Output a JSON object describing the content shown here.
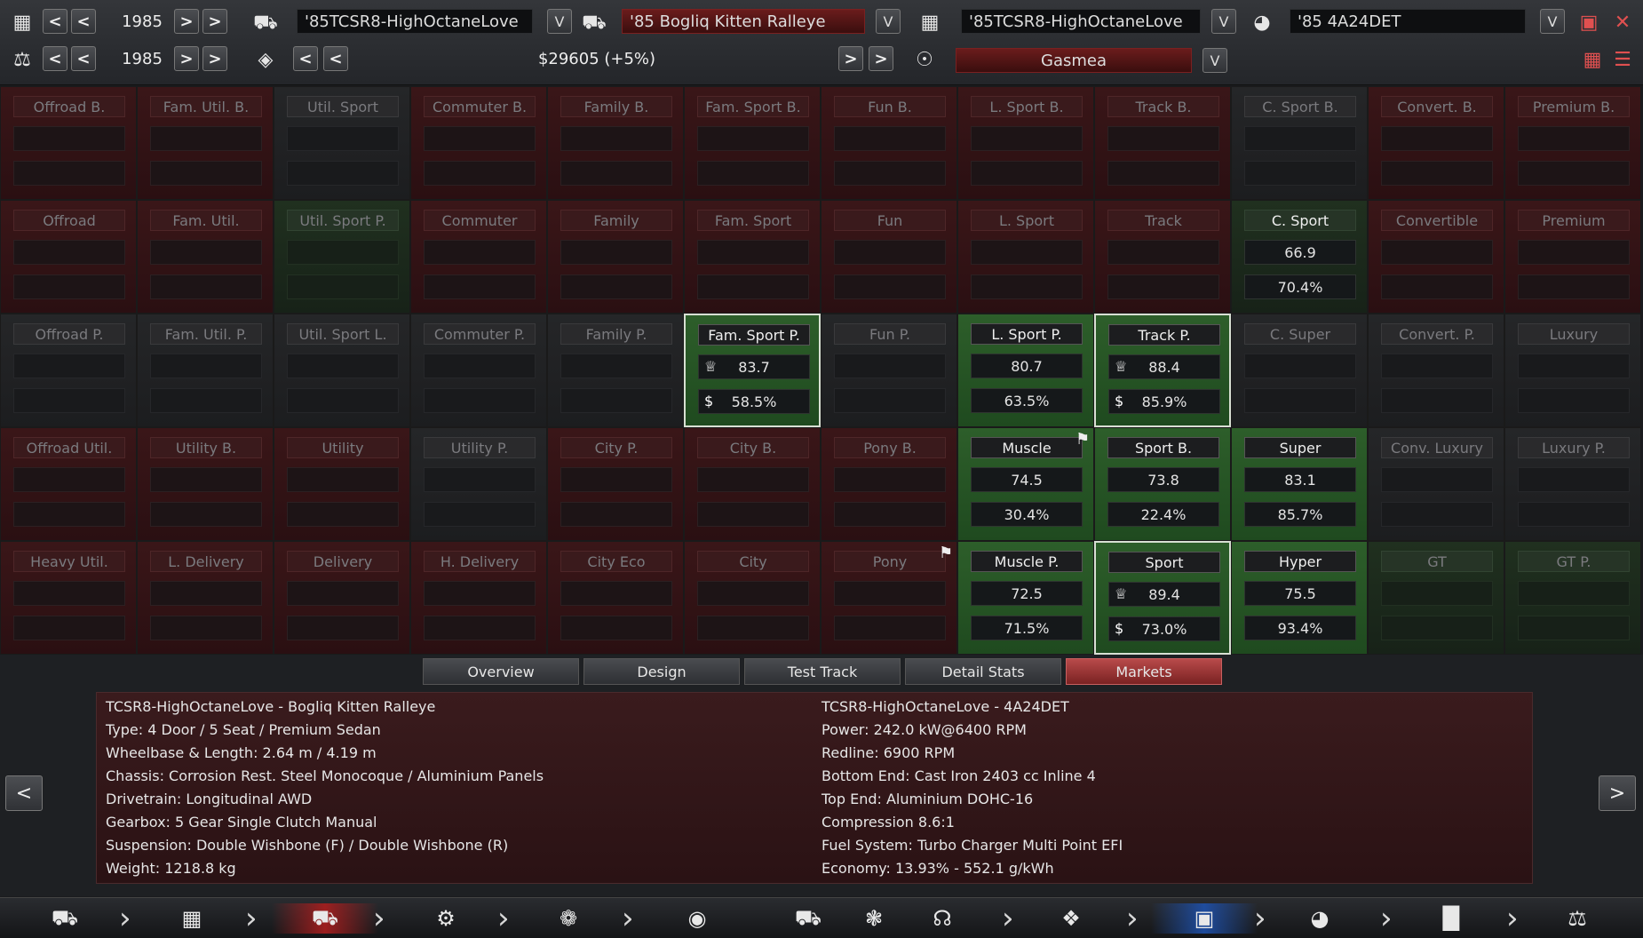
{
  "top": {
    "row1": {
      "year": "1985",
      "model": "'85TCSR8-HighOctaneLove",
      "trim": "'85   Bogliq Kitten Ralleye",
      "engine_model": "'85TCSR8-HighOctaneLove",
      "engine_variant": "'85             4A24DET"
    },
    "row2": {
      "year": "1985",
      "price": "$29605 (+5%)",
      "region": "Gasmea"
    }
  },
  "markets": [
    [
      {
        "label": "Offroad B.",
        "shade": "r"
      },
      {
        "label": "Fam. Util. B.",
        "shade": "r"
      },
      {
        "label": "Util. Sport",
        "shade": "d"
      },
      {
        "label": "Commuter B.",
        "shade": "r"
      },
      {
        "label": "Family B.",
        "shade": "r"
      },
      {
        "label": "Fam. Sport B.",
        "shade": "r"
      },
      {
        "label": "Fun B.",
        "shade": "r"
      },
      {
        "label": "L. Sport B.",
        "shade": "r"
      },
      {
        "label": "Track B.",
        "shade": "r"
      },
      {
        "label": "C. Sport B.",
        "shade": "d"
      },
      {
        "label": "Convert. B.",
        "shade": "r"
      },
      {
        "label": "Premium B.",
        "shade": "r"
      }
    ],
    [
      {
        "label": "Offroad",
        "shade": "r"
      },
      {
        "label": "Fam. Util.",
        "shade": "r"
      },
      {
        "label": "Util. Sport P.",
        "shade": "g"
      },
      {
        "label": "Commuter",
        "shade": "r"
      },
      {
        "label": "Family",
        "shade": "r"
      },
      {
        "label": "Fam. Sport",
        "shade": "r"
      },
      {
        "label": "Fun",
        "shade": "r"
      },
      {
        "label": "L. Sport",
        "shade": "r"
      },
      {
        "label": "Track",
        "shade": "r"
      },
      {
        "label": "C. Sport",
        "shade": "g",
        "active": true,
        "score": "66.9",
        "share": "70.4%"
      },
      {
        "label": "Convertible",
        "shade": "r"
      },
      {
        "label": "Premium",
        "shade": "r"
      }
    ],
    [
      {
        "label": "Offroad P.",
        "shade": "d"
      },
      {
        "label": "Fam. Util. P.",
        "shade": "d"
      },
      {
        "label": "Util. Sport L.",
        "shade": "d"
      },
      {
        "label": "Commuter P.",
        "shade": "d"
      },
      {
        "label": "Family P.",
        "shade": "d"
      },
      {
        "label": "Fam. Sport P.",
        "shade": "G",
        "active": true,
        "hl": true,
        "trophy": true,
        "score": "83.7",
        "share": "58.5%"
      },
      {
        "label": "Fun P.",
        "shade": "d"
      },
      {
        "label": "L. Sport P.",
        "shade": "G",
        "active": true,
        "score": "80.7",
        "share": "63.5%"
      },
      {
        "label": "Track P.",
        "shade": "G",
        "active": true,
        "hl": true,
        "trophy": true,
        "score": "88.4",
        "share": "85.9%"
      },
      {
        "label": "C. Super",
        "shade": "d"
      },
      {
        "label": "Convert. P.",
        "shade": "d"
      },
      {
        "label": "Luxury",
        "shade": "d"
      }
    ],
    [
      {
        "label": "Offroad Util.",
        "shade": "r"
      },
      {
        "label": "Utility B.",
        "shade": "r"
      },
      {
        "label": "Utility",
        "shade": "r"
      },
      {
        "label": "Utility P.",
        "shade": "d"
      },
      {
        "label": "City P.",
        "shade": "r"
      },
      {
        "label": "City B.",
        "shade": "r"
      },
      {
        "label": "Pony B.",
        "shade": "r"
      },
      {
        "label": "Muscle",
        "shade": "G",
        "active": true,
        "pin": true,
        "score": "74.5",
        "share": "30.4%"
      },
      {
        "label": "Sport B.",
        "shade": "G",
        "active": true,
        "score": "73.8",
        "share": "22.4%"
      },
      {
        "label": "Super",
        "shade": "G",
        "active": true,
        "score": "83.1",
        "share": "85.7%"
      },
      {
        "label": "Conv. Luxury",
        "shade": "d"
      },
      {
        "label": "Luxury P.",
        "shade": "d"
      }
    ],
    [
      {
        "label": "Heavy Util.",
        "shade": "r"
      },
      {
        "label": "L. Delivery",
        "shade": "r"
      },
      {
        "label": "Delivery",
        "shade": "r"
      },
      {
        "label": "H. Delivery",
        "shade": "r"
      },
      {
        "label": "City Eco",
        "shade": "r"
      },
      {
        "label": "City",
        "shade": "r"
      },
      {
        "label": "Pony",
        "shade": "r",
        "pin": true
      },
      {
        "label": "Muscle P.",
        "shade": "G",
        "active": true,
        "score": "72.5",
        "share": "71.5%"
      },
      {
        "label": "Sport",
        "shade": "G",
        "active": true,
        "hl": true,
        "trophy": true,
        "score": "89.4",
        "share": "73.0%"
      },
      {
        "label": "Hyper",
        "shade": "G",
        "active": true,
        "score": "75.5",
        "share": "93.4%"
      },
      {
        "label": "GT",
        "shade": "g"
      },
      {
        "label": "GT P.",
        "shade": "g"
      }
    ]
  ],
  "tabs": [
    "Overview",
    "Design",
    "Test Track",
    "Detail Stats",
    "Markets"
  ],
  "active_tab": "Markets",
  "info_left": [
    "TCSR8-HighOctaneLove - Bogliq Kitten Ralleye",
    "Type: 4 Door / 5 Seat / Premium Sedan",
    "Wheelbase & Length: 2.64 m / 4.19 m",
    "Chassis: Corrosion Rest. Steel Monocoque / Aluminium Panels",
    "Drivetrain: Longitudinal AWD",
    "Gearbox: 5 Gear Single Clutch Manual",
    "Suspension: Double Wishbone (F) / Double Wishbone (R)",
    "Weight: 1218.8 kg"
  ],
  "info_right": [
    "TCSR8-HighOctaneLove - 4A24DET",
    "Power: 242.0 kW@6400 RPM",
    "Redline: 6900 RPM",
    "Bottom End: Cast Iron 2403 cc Inline 4",
    "Top End: Aluminium DOHC-16",
    "Compression 8.6:1",
    "Fuel System: Turbo Charger Multi Point EFI",
    "Economy: 13.93% - 552.1 g/kWh"
  ],
  "icons": {
    "trophy": "trophy-icon",
    "dollar": "dollar-icon",
    "pin": "pin-icon"
  }
}
